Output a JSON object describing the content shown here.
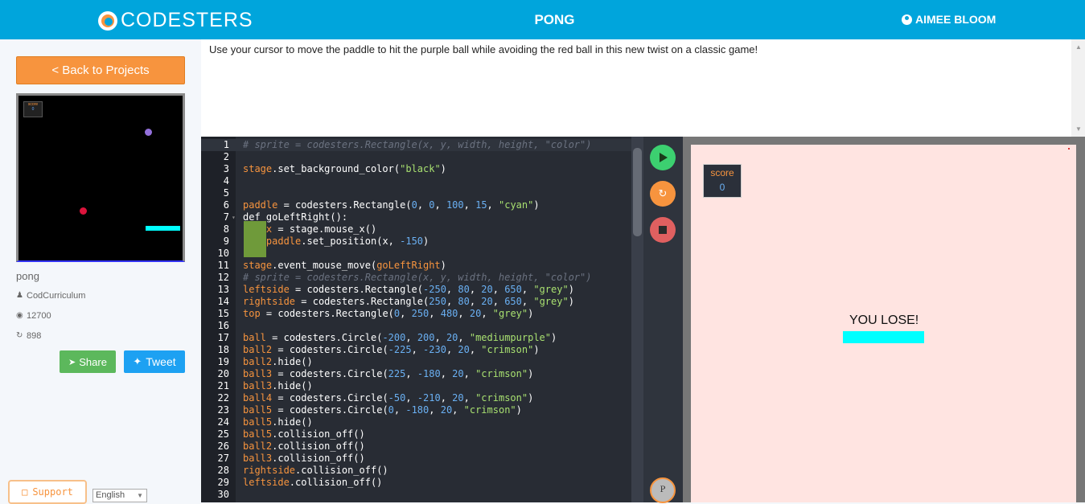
{
  "header": {
    "logo_text": "CODESTERS",
    "title": "PONG",
    "user": "AIMEE BLOOM"
  },
  "sidebar": {
    "back_label": "< Back to Projects",
    "project_name": "pong",
    "author": "CodCurriculum",
    "views": "12700",
    "remixes": "898",
    "share_label": "Share",
    "tweet_label": "Tweet",
    "support_label": "Support",
    "language": "English",
    "thumb_score_label": "score",
    "thumb_score_value": "0"
  },
  "description": "Use your cursor to move the paddle to hit the purple ball while avoiding the red ball in this new twist on a classic game!",
  "editor": {
    "line_numbers": [
      "1",
      "2",
      "3",
      "4",
      "5",
      "6",
      "7",
      "8",
      "9",
      "10",
      "11",
      "12",
      "13",
      "14",
      "15",
      "16",
      "17",
      "18",
      "19",
      "20",
      "21",
      "22",
      "23",
      "24",
      "25",
      "26",
      "27",
      "28",
      "29",
      "30"
    ],
    "lines": [
      "# sprite = codesters.Rectangle(x, y, width, height, \"color\")",
      "",
      "stage.set_background_color(\"black\")",
      "",
      "",
      "paddle = codesters.Rectangle(0, 0, 100, 15, \"cyan\")",
      "def goLeftRight():",
      "    x = stage.mouse_x()",
      "    paddle.set_position(x, -150)",
      "",
      "stage.event_mouse_move(goLeftRight)",
      "# sprite = codesters.Rectangle(x, y, width, height, \"color\")",
      "leftside = codesters.Rectangle(-250, 80, 20, 650, \"grey\")",
      "rightside = codesters.Rectangle(250, 80, 20, 650, \"grey\")",
      "top = codesters.Rectangle(0, 250, 480, 20, \"grey\")",
      "",
      "ball = codesters.Circle(-200, 200, 20, \"mediumpurple\")",
      "ball2 = codesters.Circle(-225, -230, 20, \"crimson\")",
      "ball2.hide()",
      "ball3 = codesters.Circle(225, -180, 20, \"crimson\")",
      "ball3.hide()",
      "ball4 = codesters.Circle(-50, -210, 20, \"crimson\")",
      "ball5 = codesters.Circle(0, -180, 20, \"crimson\")",
      "ball5.hide()",
      "ball5.collision_off()",
      "ball2.collision_off()",
      "ball3.collision_off()",
      "rightside.collision_off()",
      "leftside.collision_off()",
      ""
    ]
  },
  "controls": {
    "play_icon": "play-icon",
    "reload_icon": "reload-icon",
    "stop_icon": "stop-icon",
    "p_label": "P"
  },
  "stage": {
    "score_label": "score",
    "score_value": "0",
    "message": "YOU LOSE!"
  },
  "colors": {
    "header": "#00a5dc",
    "accent": "#f7943e",
    "editor_bg": "#282c34",
    "stage_bg": "#ffe4e1",
    "paddle": "#00ffff"
  }
}
